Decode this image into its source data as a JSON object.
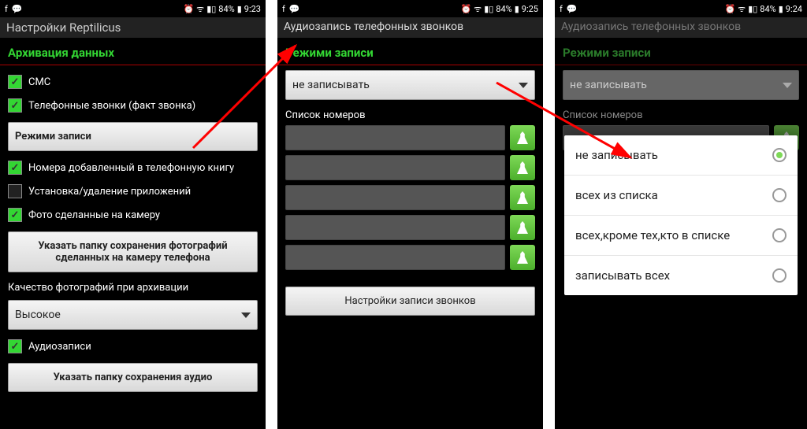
{
  "status": {
    "battery": "84%",
    "t1": "9:23",
    "t2": "9:25",
    "t3": "9:24"
  },
  "s1": {
    "appbar": "Настройки Reptilicus",
    "section": "Архивация данных",
    "items": {
      "sms": "СМС",
      "calls": "Телефонные звонки (факт звонка)",
      "modes_btn": "Режими записи",
      "contacts": "Номера добавленный в телефонную книгу",
      "apps": "Установка/удаление приложений",
      "photos": "Фото сделанные на камеру",
      "photo_folder_btn": "Указать папку сохранения фотографий сделанных на камеру телефона",
      "quality_label": "Качество фотографий при архивации",
      "quality_value": "Высокое",
      "audio": "Аудиозаписи",
      "audio_folder_btn": "Указать папку сохранения аудио"
    }
  },
  "s2": {
    "appbar": "Аудиозапись телефонных звонков",
    "section": "Режими записи",
    "dropdown": "не записывать",
    "list_label": "Список номеров",
    "settings_btn": "Настройки записи звонков"
  },
  "s3": {
    "appbar": "Аудиозапись телефонных звонков",
    "section": "Режими записи",
    "dropdown": "не записывать",
    "list_label": "Список номеров",
    "options": [
      "не записывать",
      "всех из списка",
      "всех,кроме тех,кто в списке",
      "записывать всех"
    ]
  }
}
